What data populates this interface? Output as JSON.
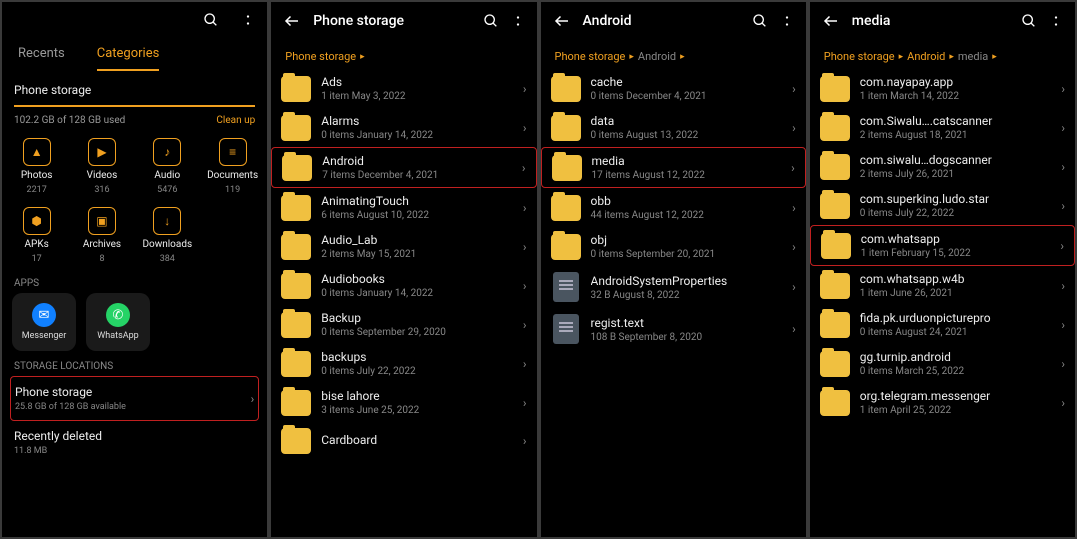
{
  "screen1": {
    "tabs": {
      "recents": "Recents",
      "categories": "Categories"
    },
    "storage_label": "Phone storage",
    "usage": "102.2 GB of 128 GB used",
    "cleanup": "Clean up",
    "categories": [
      {
        "name": "Photos",
        "count": "2217"
      },
      {
        "name": "Videos",
        "count": "316"
      },
      {
        "name": "Audio",
        "count": "5476"
      },
      {
        "name": "Documents",
        "count": "119"
      },
      {
        "name": "APKs",
        "count": "17"
      },
      {
        "name": "Archives",
        "count": "8"
      },
      {
        "name": "Downloads",
        "count": "384"
      }
    ],
    "apps_label": "APPS",
    "apps": [
      {
        "name": "Messenger"
      },
      {
        "name": "WhatsApp"
      }
    ],
    "locations_label": "STORAGE LOCATIONS",
    "phone_storage": {
      "title": "Phone storage",
      "sub": "25.8 GB of 128 GB available"
    },
    "recently_deleted": {
      "title": "Recently deleted",
      "sub": "11.8 MB"
    }
  },
  "screen2": {
    "title": "Phone storage",
    "crumbs": [
      "Phone storage"
    ],
    "files": [
      {
        "name": "Ads",
        "meta": "1 item    May 3, 2022",
        "type": "folder"
      },
      {
        "name": "Alarms",
        "meta": "0 items    January 14, 2022",
        "type": "folder"
      },
      {
        "name": "Android",
        "meta": "7 items    December 4, 2021",
        "type": "folder",
        "hl": true
      },
      {
        "name": "AnimatingTouch",
        "meta": "6 items    August 10, 2022",
        "type": "folder"
      },
      {
        "name": "Audio_Lab",
        "meta": "2 items    May 15, 2021",
        "type": "folder"
      },
      {
        "name": "Audiobooks",
        "meta": "0 items    January 14, 2022",
        "type": "folder"
      },
      {
        "name": "Backup",
        "meta": "0 items    September 29, 2020",
        "type": "folder"
      },
      {
        "name": "backups",
        "meta": "0 items    July 22, 2022",
        "type": "folder"
      },
      {
        "name": "bise lahore",
        "meta": "3 items    June 25, 2022",
        "type": "folder"
      },
      {
        "name": "Cardboard",
        "meta": "",
        "type": "folder"
      }
    ]
  },
  "screen3": {
    "title": "Android",
    "crumbs": [
      "Phone storage",
      "Android"
    ],
    "files": [
      {
        "name": "cache",
        "meta": "0 items    December 4, 2021",
        "type": "folder"
      },
      {
        "name": "data",
        "meta": "0 items    August 13, 2022",
        "type": "folder"
      },
      {
        "name": "media",
        "meta": "17 items    August 12, 2022",
        "type": "folder",
        "hl": true
      },
      {
        "name": "obb",
        "meta": "44 items    August 12, 2022",
        "type": "folder"
      },
      {
        "name": "obj",
        "meta": "0 items    September 20, 2021",
        "type": "folder"
      },
      {
        "name": "AndroidSystemProperties",
        "meta": "32 B    August 8, 2022",
        "type": "doc"
      },
      {
        "name": "regist.text",
        "meta": "108 B    September 8, 2020",
        "type": "doc"
      }
    ]
  },
  "screen4": {
    "title": "media",
    "crumbs": [
      "Phone storage",
      "Android",
      "media"
    ],
    "files": [
      {
        "name": "com.nayapay.app",
        "meta": "1 item    March 14, 2022",
        "type": "folder"
      },
      {
        "name": "com.Siwalu….catscanner",
        "meta": "2 items    August 18, 2021",
        "type": "folder"
      },
      {
        "name": "com.siwalu…dogscanner",
        "meta": "2 items    July 26, 2021",
        "type": "folder"
      },
      {
        "name": "com.superking.ludo.star",
        "meta": "0 items    July 22, 2022",
        "type": "folder"
      },
      {
        "name": "com.whatsapp",
        "meta": "1 item    February 15, 2022",
        "type": "folder",
        "hl": true
      },
      {
        "name": "com.whatsapp.w4b",
        "meta": "1 item    June 26, 2021",
        "type": "folder"
      },
      {
        "name": "fida.pk.urduonpicturepro",
        "meta": "0 items    August 24, 2021",
        "type": "folder"
      },
      {
        "name": "gg.turnip.android",
        "meta": "0 items    March 25, 2022",
        "type": "folder"
      },
      {
        "name": "org.telegram.messenger",
        "meta": "1 item    April 25, 2022",
        "type": "folder"
      }
    ]
  }
}
